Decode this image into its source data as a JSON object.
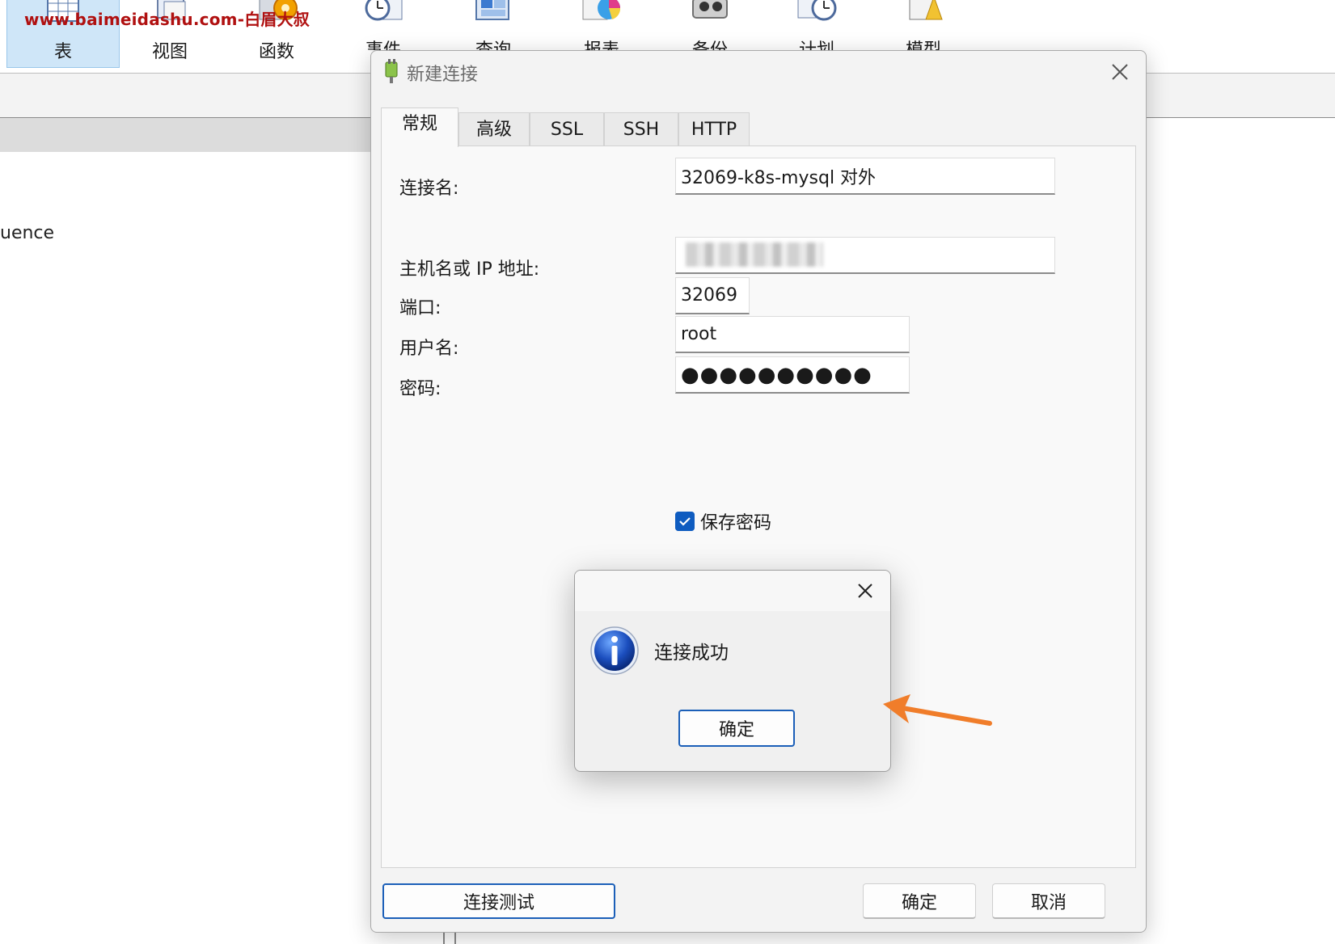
{
  "watermark": "www.baimeidashu.com-白眉大叔",
  "toolbar": {
    "items": [
      {
        "label": "表",
        "icon": "table-icon"
      },
      {
        "label": "视图",
        "icon": "view-icon"
      },
      {
        "label": "函数",
        "icon": "function-icon"
      },
      {
        "label": "事件",
        "icon": "event-icon"
      },
      {
        "label": "查询",
        "icon": "query-icon"
      },
      {
        "label": "报表",
        "icon": "report-icon"
      },
      {
        "label": "备份",
        "icon": "backup-icon"
      },
      {
        "label": "计划",
        "icon": "schedule-icon"
      },
      {
        "label": "模型",
        "icon": "model-icon"
      }
    ]
  },
  "left_pane": {
    "item_text": "uence"
  },
  "dialog": {
    "title": "新建连接",
    "tabs": [
      "常规",
      "高级",
      "SSL",
      "SSH",
      "HTTP"
    ],
    "fields": {
      "connection_name": {
        "label": "连接名:",
        "value": "32069-k8s-mysql 对外"
      },
      "host": {
        "label": "主机名或 IP 地址:",
        "value": ""
      },
      "port": {
        "label": "端口:",
        "value": "32069"
      },
      "username": {
        "label": "用户名:",
        "value": "root"
      },
      "password": {
        "label": "密码:",
        "value": "●●●●●●●●●●"
      }
    },
    "save_password": {
      "label": "保存密码",
      "checked": true
    },
    "buttons": {
      "test": "连接测试",
      "ok": "确定",
      "cancel": "取消"
    }
  },
  "message_box": {
    "text": "连接成功",
    "ok": "确定"
  },
  "colors": {
    "accent": "#1b5fb8",
    "checkbox": "#0f5cc0",
    "annotation_arrow": "#f07d2a",
    "watermark": "#b01010"
  }
}
